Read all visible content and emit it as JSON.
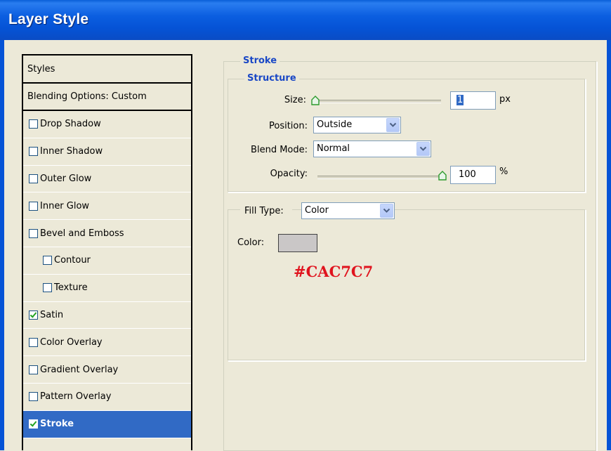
{
  "window": {
    "title": "Layer Style"
  },
  "styles_list": {
    "header": "Styles",
    "blending": "Blending Options: Custom",
    "items": [
      {
        "label": "Drop Shadow",
        "checked": false,
        "indent": false,
        "selected": false
      },
      {
        "label": "Inner Shadow",
        "checked": false,
        "indent": false,
        "selected": false
      },
      {
        "label": "Outer Glow",
        "checked": false,
        "indent": false,
        "selected": false
      },
      {
        "label": "Inner Glow",
        "checked": false,
        "indent": false,
        "selected": false
      },
      {
        "label": "Bevel and Emboss",
        "checked": false,
        "indent": false,
        "selected": false
      },
      {
        "label": "Contour",
        "checked": false,
        "indent": true,
        "selected": false
      },
      {
        "label": "Texture",
        "checked": false,
        "indent": true,
        "selected": false
      },
      {
        "label": "Satin",
        "checked": true,
        "indent": false,
        "selected": false
      },
      {
        "label": "Color Overlay",
        "checked": false,
        "indent": false,
        "selected": false
      },
      {
        "label": "Gradient Overlay",
        "checked": false,
        "indent": false,
        "selected": false
      },
      {
        "label": "Pattern Overlay",
        "checked": false,
        "indent": false,
        "selected": false
      },
      {
        "label": "Stroke",
        "checked": true,
        "indent": false,
        "selected": true
      }
    ]
  },
  "stroke": {
    "legend": "Stroke",
    "structure": {
      "legend": "Structure",
      "size_label": "Size:",
      "size_value": "1",
      "size_unit": "px",
      "size_slider_fraction": 0.0,
      "position_label": "Position:",
      "position_value": "Outside",
      "blend_label": "Blend Mode:",
      "blend_value": "Normal",
      "opacity_label": "Opacity:",
      "opacity_value": "100",
      "opacity_unit": "%",
      "opacity_slider_fraction": 1.0
    },
    "fill": {
      "type_label": "Fill Type:",
      "type_value": "Color",
      "color_label": "Color:",
      "color_hex": "#cac7c7"
    },
    "annotation": "#CAC7C7"
  },
  "colors": {
    "titlebar": "#0553d6",
    "selection": "#316ac5",
    "legend": "#1a48c6",
    "annotation": "#e0141e"
  }
}
